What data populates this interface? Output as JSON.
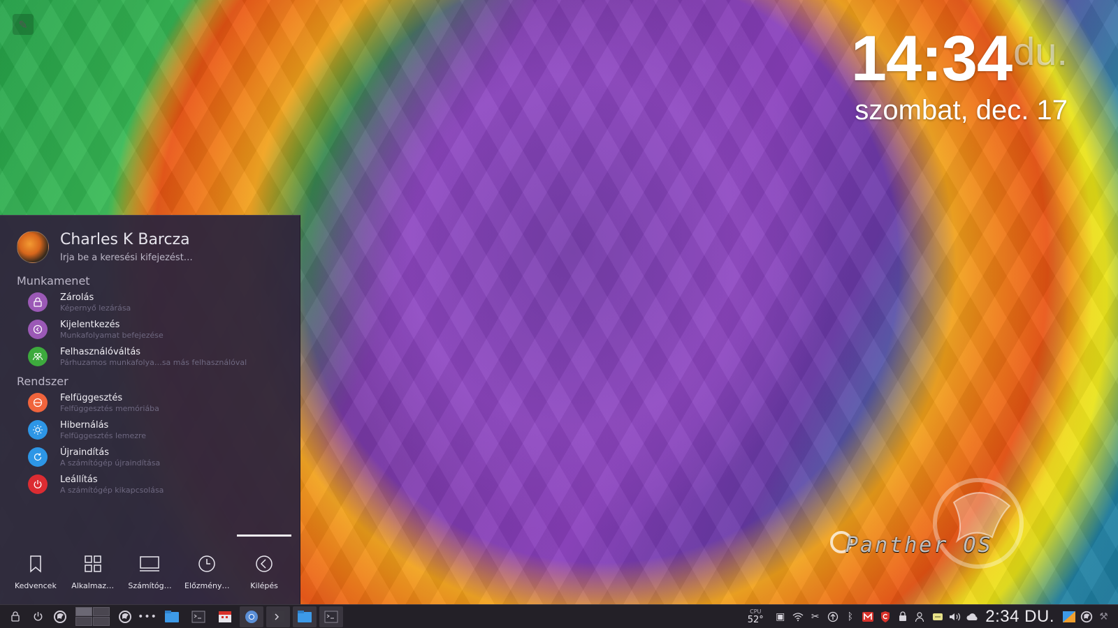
{
  "desktop": {
    "clock": {
      "time": "14:34",
      "ampm": "du.",
      "date": "szombat, dec. 17"
    },
    "logo_text": "Panther OS"
  },
  "launcher": {
    "user_name": "Charles K Barcza",
    "search_placeholder": "Írja be a keresési kifejezést…",
    "sections": {
      "session": {
        "title": "Munkamenet",
        "items": [
          {
            "label": "Zárolás",
            "desc": "Képernyő lezárása",
            "icon": "lock-icon",
            "color": "#9b59b6"
          },
          {
            "label": "Kijelentkezés",
            "desc": "Munkafolyamat befejezése",
            "icon": "logout-icon",
            "color": "#9b59b6"
          },
          {
            "label": "Felhasználóváltás",
            "desc": "Párhuzamos munkafolya…sa más felhasználóval",
            "icon": "switch-user-icon",
            "color": "#3daa3d"
          }
        ]
      },
      "system": {
        "title": "Rendszer",
        "items": [
          {
            "label": "Felfüggesztés",
            "desc": "Felfüggesztés memóriába",
            "icon": "suspend-icon",
            "color": "#f0643c"
          },
          {
            "label": "Hibernálás",
            "desc": "Felfüggesztés lemezre",
            "icon": "hibernate-icon",
            "color": "#2d96e6"
          },
          {
            "label": "Újraindítás",
            "desc": "A számítógép újraindítása",
            "icon": "restart-icon",
            "color": "#2d96e6"
          },
          {
            "label": "Leállítás",
            "desc": "A számítógép kikapcsolása",
            "icon": "shutdown-icon",
            "color": "#dc2c32"
          }
        ]
      }
    },
    "tabs": [
      {
        "label": "Kedvencek",
        "icon": "bookmark-icon"
      },
      {
        "label": "Alkalmaz…",
        "icon": "applications-icon"
      },
      {
        "label": "Számítóg…",
        "icon": "computer-icon"
      },
      {
        "label": "Előzmény…",
        "icon": "history-icon"
      },
      {
        "label": "Kilépés",
        "icon": "leave-icon",
        "active": true
      }
    ]
  },
  "taskbar": {
    "cpu_label": "CPU",
    "cpu_value": "52°",
    "clock": "2:34 DU."
  }
}
